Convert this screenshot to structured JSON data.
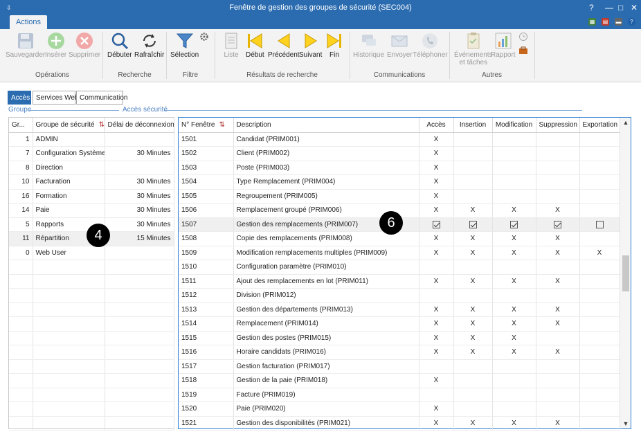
{
  "window": {
    "title": "Fenêtre de gestion des groupes de sécurité (SEC004)"
  },
  "ribbon_tab": "Actions",
  "ribbon": {
    "groups": {
      "operations": "Opérations",
      "recherche": "Recherche",
      "filtre": "Filtre",
      "resultats": "Résultats de recherche",
      "communications": "Communications",
      "autres": "Autres"
    },
    "buttons": {
      "sauvegarder": "Sauvegarder",
      "inserer": "Insérer",
      "supprimer": "Supprimer",
      "debuter": "Débuter",
      "rafraichir": "Rafraîchir",
      "selection": "Sélection",
      "liste": "Liste",
      "debut": "Début",
      "precedent": "Précédent",
      "suivant": "Suivant",
      "fin": "Fin",
      "historique": "Historique",
      "envoyer": "Envoyer",
      "telephoner": "Téléphoner",
      "evenements": "Événements",
      "evenements2": "et tâches",
      "rapport": "Rapport"
    }
  },
  "subtabs": [
    "Accès",
    "Services Web",
    "Communication"
  ],
  "sections": {
    "groupe": "Groupe",
    "acces": "Accès sécurité"
  },
  "groups_table": {
    "headers": [
      "Gr...",
      "Groupe de sécurité",
      "Délai de déconnexion"
    ],
    "rows": [
      {
        "id": "1",
        "name": "ADMIN",
        "delay": ""
      },
      {
        "id": "7",
        "name": "Configuration Système",
        "delay": "30 Minutes"
      },
      {
        "id": "8",
        "name": "Direction",
        "delay": ""
      },
      {
        "id": "10",
        "name": "Facturation",
        "delay": "30 Minutes"
      },
      {
        "id": "16",
        "name": "Formation",
        "delay": "30 Minutes"
      },
      {
        "id": "14",
        "name": "Paie",
        "delay": "30 Minutes"
      },
      {
        "id": "5",
        "name": "Rapports",
        "delay": "30 Minutes"
      },
      {
        "id": "11",
        "name": "Répartition",
        "delay": "15 Minutes"
      },
      {
        "id": "0",
        "name": "Web User",
        "delay": ""
      }
    ]
  },
  "access_table": {
    "headers": [
      "N° Fenêtre",
      "Description",
      "Accès",
      "Insertion",
      "Modification",
      "Suppression",
      "Exportation"
    ],
    "rows": [
      {
        "no": "1501",
        "desc": "Candidat (PRIM001)",
        "acces": "X",
        "ins": "",
        "mod": "",
        "sup": "",
        "exp": ""
      },
      {
        "no": "1502",
        "desc": "Client (PRIM002)",
        "acces": "X",
        "ins": "",
        "mod": "",
        "sup": "",
        "exp": ""
      },
      {
        "no": "1503",
        "desc": "Poste (PRIM003)",
        "acces": "X",
        "ins": "",
        "mod": "",
        "sup": "",
        "exp": ""
      },
      {
        "no": "1504",
        "desc": "Type Remplacement (PRIM004)",
        "acces": "X",
        "ins": "",
        "mod": "",
        "sup": "",
        "exp": ""
      },
      {
        "no": "1505",
        "desc": "Regroupement (PRIM005)",
        "acces": "X",
        "ins": "",
        "mod": "",
        "sup": "",
        "exp": ""
      },
      {
        "no": "1506",
        "desc": "Remplacement groupé (PRIM006)",
        "acces": "X",
        "ins": "X",
        "mod": "X",
        "sup": "X",
        "exp": ""
      },
      {
        "no": "1507",
        "desc": "Gestion des remplacements (PRIM007)",
        "acces": true,
        "ins": true,
        "mod": true,
        "sup": true,
        "exp": false,
        "editing": true
      },
      {
        "no": "1508",
        "desc": "Copie des remplacements (PRIM008)",
        "acces": "X",
        "ins": "X",
        "mod": "X",
        "sup": "X",
        "exp": ""
      },
      {
        "no": "1509",
        "desc": "Modification remplacements multiples (PRIM009)",
        "acces": "X",
        "ins": "X",
        "mod": "X",
        "sup": "X",
        "exp": "X"
      },
      {
        "no": "1510",
        "desc": "Configuration paramètre (PRIM010)",
        "acces": "",
        "ins": "",
        "mod": "",
        "sup": "",
        "exp": ""
      },
      {
        "no": "1511",
        "desc": "Ajout des remplacements en lot (PRIM011)",
        "acces": "X",
        "ins": "X",
        "mod": "X",
        "sup": "X",
        "exp": ""
      },
      {
        "no": "1512",
        "desc": "Division (PRIM012)",
        "acces": "",
        "ins": "",
        "mod": "",
        "sup": "",
        "exp": ""
      },
      {
        "no": "1513",
        "desc": "Gestion des départements (PRIM013)",
        "acces": "X",
        "ins": "X",
        "mod": "X",
        "sup": "X",
        "exp": ""
      },
      {
        "no": "1514",
        "desc": "Remplacement (PRIM014)",
        "acces": "X",
        "ins": "X",
        "mod": "X",
        "sup": "X",
        "exp": ""
      },
      {
        "no": "1515",
        "desc": "Gestion des postes (PRIM015)",
        "acces": "X",
        "ins": "X",
        "mod": "X",
        "sup": "",
        "exp": ""
      },
      {
        "no": "1516",
        "desc": "Horaire candidats (PRIM016)",
        "acces": "X",
        "ins": "X",
        "mod": "X",
        "sup": "X",
        "exp": ""
      },
      {
        "no": "1517",
        "desc": "Gestion facturation (PRIM017)",
        "acces": "",
        "ins": "",
        "mod": "",
        "sup": "",
        "exp": ""
      },
      {
        "no": "1518",
        "desc": "Gestion de la paie (PRIM018)",
        "acces": "X",
        "ins": "",
        "mod": "",
        "sup": "",
        "exp": ""
      },
      {
        "no": "1519",
        "desc": "Facture (PRIM019)",
        "acces": "",
        "ins": "",
        "mod": "",
        "sup": "",
        "exp": ""
      },
      {
        "no": "1520",
        "desc": "Paie (PRIM020)",
        "acces": "X",
        "ins": "",
        "mod": "",
        "sup": "",
        "exp": ""
      },
      {
        "no": "1521",
        "desc": "Gestion des disponibilités (PRIM021)",
        "acces": "X",
        "ins": "X",
        "mod": "X",
        "sup": "X",
        "exp": ""
      }
    ]
  },
  "markers": {
    "m4": "4",
    "m6": "6"
  },
  "colors": {
    "titlebar": "#2b6cb0",
    "accent": "#2b7fd4",
    "selected_row": "#f0f0f0"
  }
}
